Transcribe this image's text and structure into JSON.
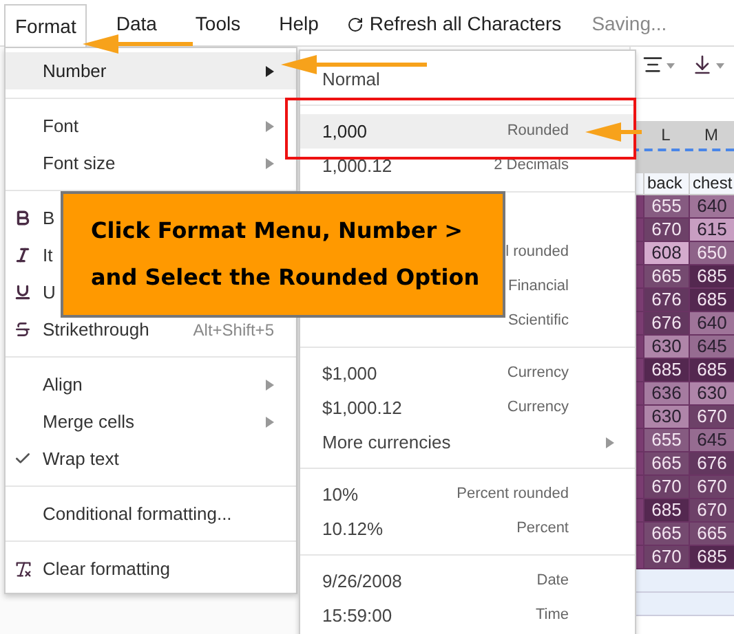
{
  "menubar": {
    "items": [
      {
        "label": "Format",
        "selected": true
      },
      {
        "label": "Data",
        "selected": false
      },
      {
        "label": "Tools",
        "selected": false
      },
      {
        "label": "Help",
        "selected": false
      }
    ],
    "refresh": {
      "label": "Refresh all Characters"
    },
    "status": "Saving..."
  },
  "format_menu": {
    "groups": [
      [
        {
          "kind": "submenu",
          "label": "Number",
          "selected": true,
          "checked": false
        }
      ],
      [
        {
          "kind": "submenu",
          "label": "Font",
          "selected": false,
          "checked": false
        },
        {
          "kind": "submenu",
          "label": "Font size",
          "selected": false,
          "checked": false
        }
      ],
      [
        {
          "kind": "bold",
          "label": "B",
          "selected": false,
          "checked": false
        },
        {
          "kind": "italic",
          "label": "It",
          "selected": false,
          "checked": false
        },
        {
          "kind": "underline",
          "label": "U",
          "selected": false,
          "checked": false
        },
        {
          "kind": "strikethrough",
          "label": "Strikethrough",
          "shortcut": "Alt+Shift+5",
          "selected": false,
          "checked": false
        }
      ],
      [
        {
          "kind": "submenu",
          "label": "Align",
          "selected": false,
          "checked": false
        },
        {
          "kind": "submenu",
          "label": "Merge cells",
          "selected": false,
          "checked": false
        },
        {
          "kind": "plain",
          "label": "Wrap text",
          "selected": false,
          "checked": true
        }
      ],
      [
        {
          "kind": "plain",
          "label": "Conditional formatting...",
          "selected": false,
          "checked": false
        }
      ],
      [
        {
          "kind": "clear",
          "label": "Clear formatting",
          "selected": false,
          "checked": false
        }
      ]
    ]
  },
  "number_menu": {
    "groups": [
      [
        {
          "kind": "format",
          "value": "Normal",
          "selected": false
        }
      ],
      [
        {
          "kind": "format",
          "value": "1,000",
          "format": "Rounded",
          "selected": true
        },
        {
          "kind": "format",
          "value": "1,000.12",
          "format": "2 Decimals",
          "selected": false
        }
      ],
      [
        {
          "kind": "format",
          "format": "l rounded",
          "selected": false
        },
        {
          "kind": "format",
          "format": "Financial",
          "selected": false
        },
        {
          "kind": "format",
          "format": "Scientific",
          "selected": false
        }
      ],
      [
        {
          "kind": "format",
          "value": "$1,000",
          "format": "Currency",
          "selected": false
        },
        {
          "kind": "format",
          "value": "$1,000.12",
          "format": "Currency",
          "selected": false
        },
        {
          "kind": "submenu",
          "value": "More currencies",
          "selected": false
        }
      ],
      [
        {
          "kind": "format",
          "value": "10%",
          "format": "Percent rounded",
          "selected": false
        },
        {
          "kind": "format",
          "value": "10.12%",
          "format": "Percent",
          "selected": false
        }
      ],
      [
        {
          "kind": "format",
          "value": "9/26/2008",
          "format": "Date",
          "selected": false
        },
        {
          "kind": "format",
          "value": "15:59:00",
          "format": "Time",
          "selected": false
        }
      ]
    ]
  },
  "callout": {
    "lines": [
      "Click Format Menu, Number >",
      "and Select the Rounded Option"
    ]
  },
  "sheet": {
    "columns": [
      {
        "label": "L"
      },
      {
        "label": "M"
      }
    ],
    "headers": [
      "back",
      "chest"
    ],
    "rows": [
      [
        "655",
        "640"
      ],
      [
        "670",
        "615"
      ],
      [
        "608",
        "650"
      ],
      [
        "665",
        "685"
      ],
      [
        "676",
        "685"
      ],
      [
        "676",
        "640"
      ],
      [
        "630",
        "645"
      ],
      [
        "685",
        "685"
      ],
      [
        "636",
        "630"
      ],
      [
        "630",
        "670"
      ],
      [
        "655",
        "645"
      ],
      [
        "665",
        "676"
      ],
      [
        "670",
        "670"
      ],
      [
        "685",
        "670"
      ],
      [
        "665",
        "665"
      ],
      [
        "670",
        "685"
      ]
    ]
  }
}
